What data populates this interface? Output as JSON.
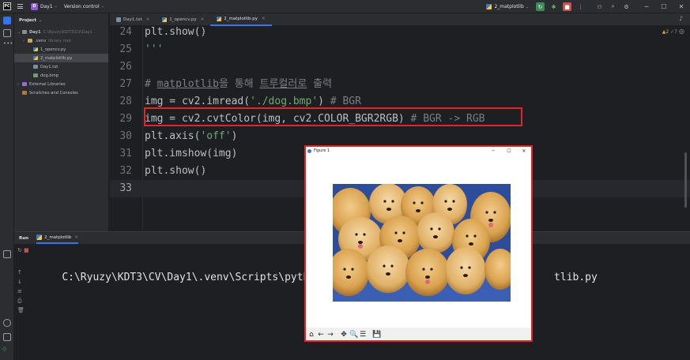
{
  "titlebar": {
    "logo_letters": "PC",
    "project_badge": "D",
    "project_name": "Day1",
    "vcs_label": "Version control",
    "run_config": "2_matplotlib"
  },
  "project_panel": {
    "header": "Project",
    "items": [
      {
        "label": "Day1",
        "note": "C:\\Ryuzy\\KDT3\\CV\\Day1",
        "type": "folder",
        "indent": 0,
        "twisty": "⌄"
      },
      {
        "label": ".venv",
        "note": "library root",
        "type": "venvf",
        "indent": 1,
        "twisty": "›"
      },
      {
        "label": "1_opencv.py",
        "note": "",
        "type": "py",
        "indent": 2,
        "twisty": ""
      },
      {
        "label": "2_matplotlib.py",
        "note": "",
        "type": "py",
        "indent": 2,
        "twisty": "",
        "selected": true
      },
      {
        "label": "Day1.txt",
        "note": "",
        "type": "txt",
        "indent": 2,
        "twisty": ""
      },
      {
        "label": "dog.bmp",
        "note": "",
        "type": "img",
        "indent": 2,
        "twisty": ""
      },
      {
        "label": "External Libraries",
        "note": "",
        "type": "lib",
        "indent": 0,
        "twisty": "›"
      },
      {
        "label": "Scratches and Consoles",
        "note": "",
        "type": "scr",
        "indent": 0,
        "twisty": ""
      }
    ]
  },
  "tabs": [
    {
      "label": "Day1.txt",
      "active": false
    },
    {
      "label": "1_opencv.py",
      "active": false
    },
    {
      "label": "2_matplotlib.py",
      "active": true
    }
  ],
  "editor": {
    "inspections": {
      "warnings": "▲2",
      "ok": "✓7"
    },
    "lines": [
      {
        "num": "24",
        "code": "plt.show()"
      },
      {
        "num": "25",
        "code": "'''"
      },
      {
        "num": "26",
        "code": ""
      },
      {
        "num": "27",
        "code": "# matplotlib을 통해 트루컬러로 출력"
      },
      {
        "num": "28",
        "code": "img = cv2.imread('./dog.bmp') # BGR"
      },
      {
        "num": "29",
        "code": "img = cv2.cvtColor(img, cv2.COLOR_BGR2RGB) # BGR -> RGB"
      },
      {
        "num": "30",
        "code": "plt.axis('off')"
      },
      {
        "num": "31",
        "code": "plt.imshow(img)"
      },
      {
        "num": "32",
        "code": "plt.show()"
      },
      {
        "num": "33",
        "code": ""
      }
    ]
  },
  "run_panel": {
    "label": "Run",
    "tab": "2_matplotlib",
    "console_left": "C:\\Ryuzy\\KDT3\\CV\\Day1\\.venv\\Scripts\\python",
    "console_right": "tlib.py"
  },
  "figure": {
    "title": "Figure 1",
    "min": "─",
    "max": "☐",
    "close": "✕",
    "tools": [
      "⌂",
      "←",
      "→",
      "✥",
      "🔍",
      "☰",
      "💾"
    ]
  },
  "colors": {
    "accent": "#3574f0",
    "highlight_box": "#e1252a",
    "string": "#6aab73",
    "comment": "#7a7e85"
  }
}
